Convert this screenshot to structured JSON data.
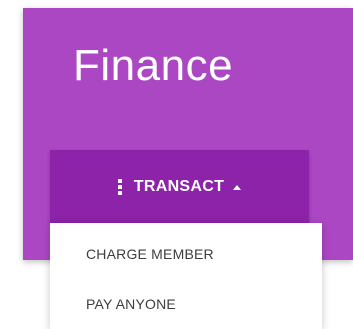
{
  "card": {
    "title": "Finance",
    "color": "#ac47c4"
  },
  "transact_button": {
    "label": "TRANSACT",
    "icon": "more-vert-icon",
    "caret_icon": "caret-up-icon",
    "color": "#8c23a8"
  },
  "menu": {
    "items": [
      {
        "label": "CHARGE MEMBER"
      },
      {
        "label": "PAY ANYONE"
      }
    ]
  }
}
